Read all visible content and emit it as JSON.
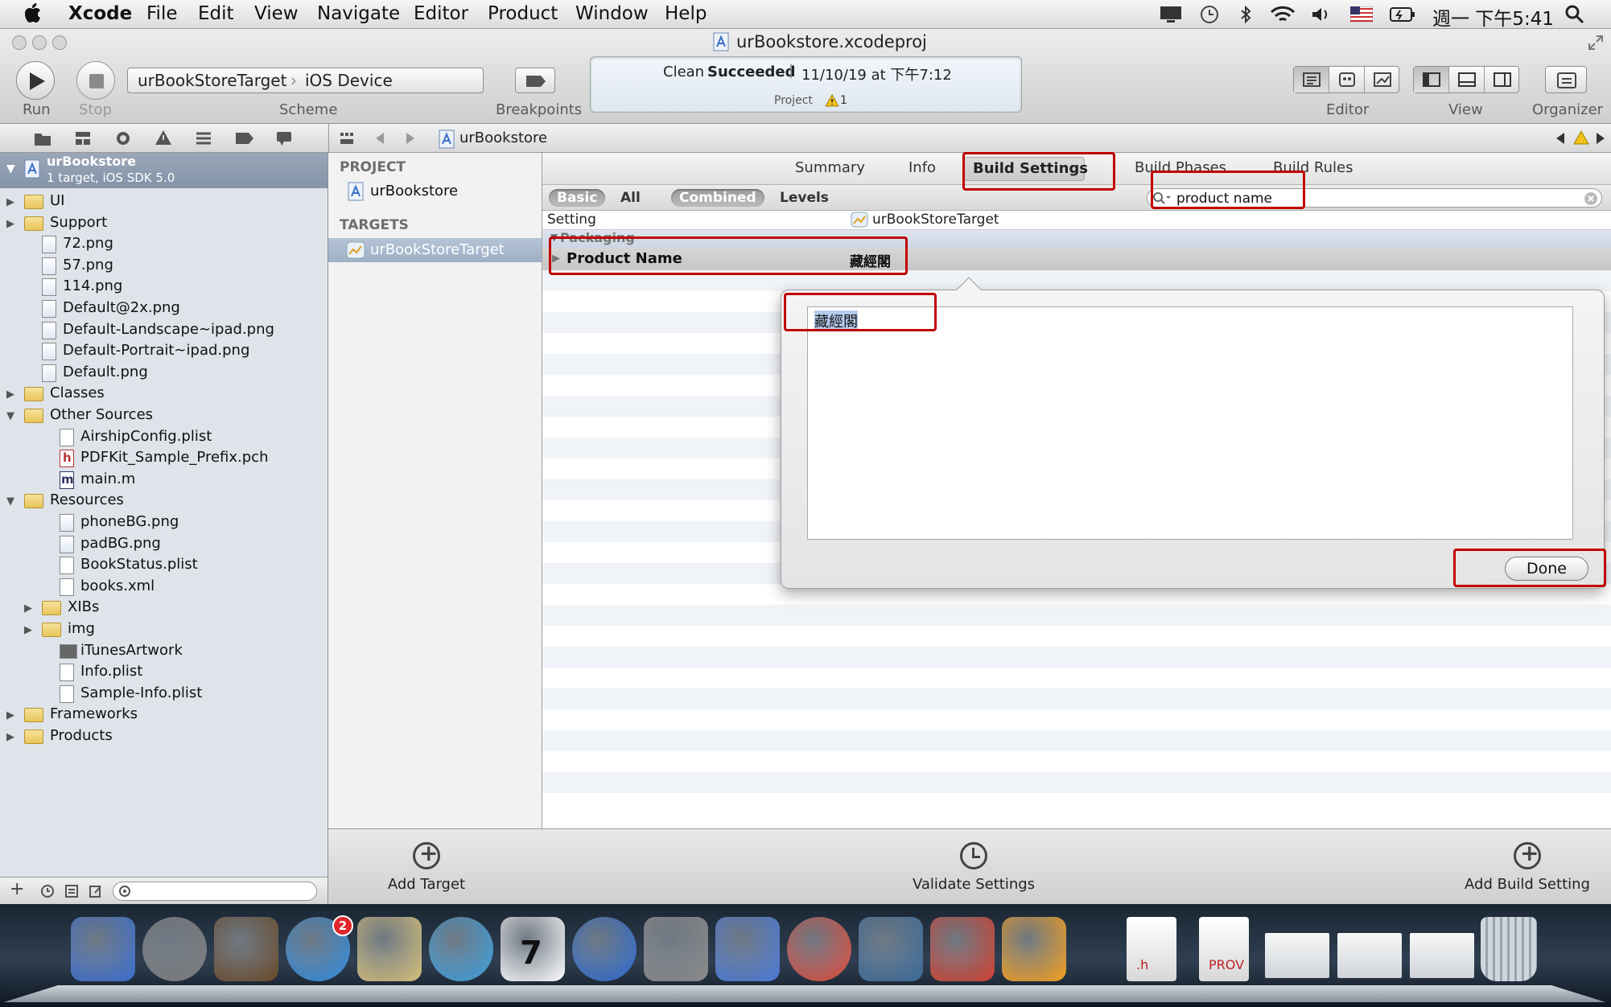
{
  "menubar": {
    "app": "Xcode",
    "items": [
      "File",
      "Edit",
      "View",
      "Navigate",
      "Editor",
      "Product",
      "Window",
      "Help"
    ],
    "clock": "週一 下午5:41"
  },
  "window": {
    "title": "urBookstore.xcodeproj",
    "toolbar": {
      "run_label": "Run",
      "stop_label": "Stop",
      "scheme_target": "urBookStoreTarget",
      "scheme_device": "iOS Device",
      "scheme_label": "Scheme",
      "breakpoints_label": "Breakpoints",
      "editor_label": "Editor",
      "view_label": "View",
      "organizer_label": "Organizer"
    },
    "status": {
      "action": "Clean",
      "result": "Succeeded",
      "timestamp": "11/10/19 at 下午7:12",
      "project_label": "Project",
      "warning_count": "1"
    }
  },
  "jumpbar": {
    "crumb": "urBookstore"
  },
  "navigator": {
    "root": {
      "name": "urBookstore",
      "subtitle": "1 target, iOS SDK 5.0"
    },
    "items": [
      {
        "label": "UI",
        "kind": "folder",
        "expanded": false
      },
      {
        "label": "Support",
        "kind": "folder",
        "expanded": false
      },
      {
        "label": "72.png",
        "kind": "image"
      },
      {
        "label": "57.png",
        "kind": "image"
      },
      {
        "label": "114.png",
        "kind": "image"
      },
      {
        "label": "Default@2x.png",
        "kind": "image"
      },
      {
        "label": "Default-Landscape~ipad.png",
        "kind": "image"
      },
      {
        "label": "Default-Portrait~ipad.png",
        "kind": "image"
      },
      {
        "label": "Default.png",
        "kind": "image"
      },
      {
        "label": "Classes",
        "kind": "folder",
        "expanded": false
      },
      {
        "label": "Other Sources",
        "kind": "folder",
        "expanded": true
      },
      {
        "label": "AirshipConfig.plist",
        "kind": "plist"
      },
      {
        "label": "PDFKit_Sample_Prefix.pch",
        "kind": "header"
      },
      {
        "label": "main.m",
        "kind": "source"
      },
      {
        "label": "Resources",
        "kind": "folder",
        "expanded": true
      },
      {
        "label": "phoneBG.png",
        "kind": "image"
      },
      {
        "label": "padBG.png",
        "kind": "image"
      },
      {
        "label": "BookStatus.plist",
        "kind": "plist"
      },
      {
        "label": "books.xml",
        "kind": "plist"
      },
      {
        "label": "XIBs",
        "kind": "folder",
        "expanded": false
      },
      {
        "label": "img",
        "kind": "folder",
        "expanded": false
      },
      {
        "label": "iTunesArtwork",
        "kind": "file"
      },
      {
        "label": "Info.plist",
        "kind": "plist"
      },
      {
        "label": "Sample-Info.plist",
        "kind": "plist"
      },
      {
        "label": "Frameworks",
        "kind": "folder",
        "expanded": false
      },
      {
        "label": "Products",
        "kind": "folder",
        "expanded": false
      }
    ]
  },
  "project_pane": {
    "project_header": "PROJECT",
    "project_item": "urBookstore",
    "targets_header": "TARGETS",
    "target_item": "urBookStoreTarget"
  },
  "editor": {
    "tabs": [
      "Summary",
      "Info",
      "Build Settings",
      "Build Phases",
      "Build Rules"
    ],
    "selected_tab": "Build Settings",
    "filters": [
      "Basic",
      "All",
      "Combined",
      "Levels"
    ],
    "search_value": "product name",
    "column_setting": "Setting",
    "column_target": "urBookStoreTarget",
    "group": "Packaging",
    "row": {
      "name": "Product Name",
      "value": "藏經閣"
    },
    "popover": {
      "text": "藏經閣",
      "done_label": "Done"
    }
  },
  "bottombar": {
    "add_target": "Add Target",
    "validate": "Validate Settings",
    "add_build_setting": "Add Build Setting"
  },
  "dock": {
    "badge_count": "2",
    "calendar_day": "7",
    "apps": [
      "finder-icon",
      "launchpad-icon",
      "photo-booth-icon",
      "app-store-icon",
      "mail-icon",
      "safari-icon",
      "calendar-icon",
      "itunes-icon",
      "system-preferences-icon",
      "xcode-icon",
      "chrome-icon",
      "app-icon",
      "app-icon",
      "pps-icon"
    ],
    "docs": [
      ".h",
      "PROV"
    ]
  },
  "colors": {
    "annotation": "#c00000",
    "selection": "#a8b8cc"
  }
}
